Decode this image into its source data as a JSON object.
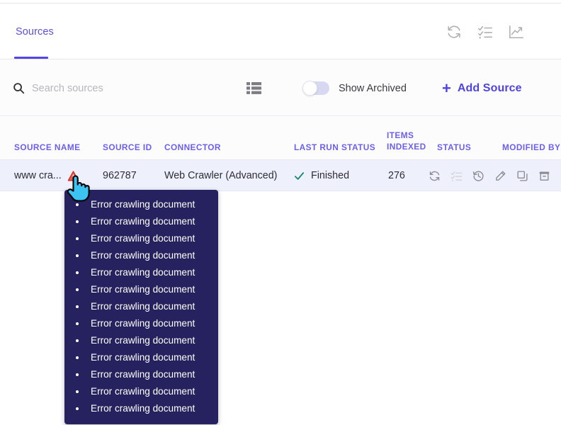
{
  "header": {
    "tabs": [
      {
        "label": "Sources",
        "active": true
      }
    ],
    "actions": [
      {
        "name": "refresh-icon",
        "label": "Refresh"
      },
      {
        "name": "tasks-icon",
        "label": "Tasks"
      },
      {
        "name": "analytics-icon",
        "label": "Analytics"
      }
    ]
  },
  "toolbar": {
    "search_placeholder": "Search sources",
    "search_value": "",
    "grid_view_label": "Column view",
    "show_archived_label": "Show Archived",
    "show_archived_on": false,
    "add_source_label": "Add Source",
    "add_source_plus": "+"
  },
  "table": {
    "columns": [
      "SOURCE NAME",
      "SOURCE ID",
      "CONNECTOR",
      "LAST RUN STATUS",
      "ITEMS INDEXED",
      "STATUS",
      "MODIFIED BY"
    ],
    "items_indexed_line1": "ITEMS",
    "items_indexed_line2": "INDEXED",
    "rows": [
      {
        "source_name": "www cra...",
        "has_warning": true,
        "source_id": "962787",
        "connector": "Web Crawler (Advanced)",
        "last_run_status": "Finished",
        "items_indexed": "276",
        "actions": [
          {
            "name": "sync-icon",
            "label": "Sync",
            "disabled": false
          },
          {
            "name": "tasks-icon",
            "label": "Tasks",
            "disabled": true
          },
          {
            "name": "history-icon",
            "label": "History",
            "disabled": false
          },
          {
            "name": "edit-icon",
            "label": "Edit",
            "disabled": false
          },
          {
            "name": "duplicate-icon",
            "label": "Duplicate",
            "disabled": false
          },
          {
            "name": "archive-icon",
            "label": "Archive",
            "disabled": false
          }
        ]
      }
    ]
  },
  "tooltip": {
    "items": [
      "Error crawling document",
      "Error crawling document",
      "Error crawling document",
      "Error crawling document",
      "Error crawling document",
      "Error crawling document",
      "Error crawling document",
      "Error crawling document",
      "Error crawling document",
      "Error crawling document",
      "Error crawling document",
      "Error crawling document",
      "Error crawling document"
    ]
  },
  "colors": {
    "accent": "#5246e8",
    "header_text": "#6b5ff0",
    "row_bg": "#eef0fb",
    "tooltip_bg": "#262260",
    "success": "#178a7a",
    "warning": "#e03028",
    "cursor": "#3bbdf0"
  }
}
